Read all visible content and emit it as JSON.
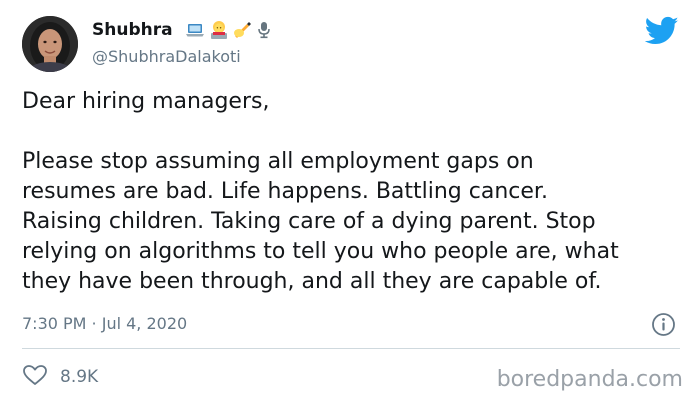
{
  "author": {
    "display_name": "Shubhra",
    "handle": "@ShubhraDalakoti",
    "name_emojis": [
      "laptop-emoji",
      "woman-technologist-emoji",
      "writing-hand-emoji",
      "microphone-emoji"
    ]
  },
  "tweet": {
    "greeting": "Dear hiring managers,",
    "body": "Please stop assuming all employment gaps on\nresumes are bad. Life happens. Battling cancer.\nRaising children. Taking care of a dying parent. Stop\nrelying on algorithms to tell you who people are, what\nthey have been through, and all they are capable of.",
    "timestamp": "7:30 PM · Jul 4, 2020"
  },
  "engagement": {
    "like_count": "8.9K"
  },
  "watermark": "boredpanda.com",
  "colors": {
    "twitter_blue": "#1da1f2",
    "text": "#14171a",
    "secondary_text": "#657786"
  },
  "icons": {
    "logo": "twitter-bird-icon",
    "info": "info-icon",
    "like": "heart-icon"
  }
}
